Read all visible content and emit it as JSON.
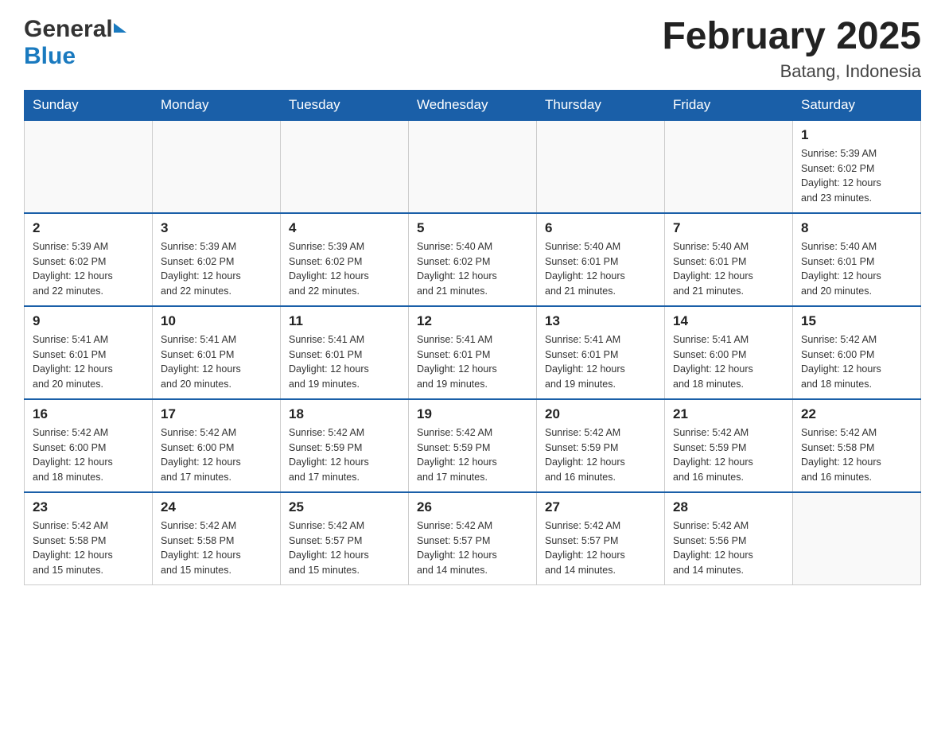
{
  "header": {
    "logo_general": "General",
    "logo_blue": "Blue",
    "month_title": "February 2025",
    "location": "Batang, Indonesia"
  },
  "weekdays": [
    "Sunday",
    "Monday",
    "Tuesday",
    "Wednesday",
    "Thursday",
    "Friday",
    "Saturday"
  ],
  "weeks": [
    [
      {
        "day": "",
        "info": ""
      },
      {
        "day": "",
        "info": ""
      },
      {
        "day": "",
        "info": ""
      },
      {
        "day": "",
        "info": ""
      },
      {
        "day": "",
        "info": ""
      },
      {
        "day": "",
        "info": ""
      },
      {
        "day": "1",
        "info": "Sunrise: 5:39 AM\nSunset: 6:02 PM\nDaylight: 12 hours\nand 23 minutes."
      }
    ],
    [
      {
        "day": "2",
        "info": "Sunrise: 5:39 AM\nSunset: 6:02 PM\nDaylight: 12 hours\nand 22 minutes."
      },
      {
        "day": "3",
        "info": "Sunrise: 5:39 AM\nSunset: 6:02 PM\nDaylight: 12 hours\nand 22 minutes."
      },
      {
        "day": "4",
        "info": "Sunrise: 5:39 AM\nSunset: 6:02 PM\nDaylight: 12 hours\nand 22 minutes."
      },
      {
        "day": "5",
        "info": "Sunrise: 5:40 AM\nSunset: 6:02 PM\nDaylight: 12 hours\nand 21 minutes."
      },
      {
        "day": "6",
        "info": "Sunrise: 5:40 AM\nSunset: 6:01 PM\nDaylight: 12 hours\nand 21 minutes."
      },
      {
        "day": "7",
        "info": "Sunrise: 5:40 AM\nSunset: 6:01 PM\nDaylight: 12 hours\nand 21 minutes."
      },
      {
        "day": "8",
        "info": "Sunrise: 5:40 AM\nSunset: 6:01 PM\nDaylight: 12 hours\nand 20 minutes."
      }
    ],
    [
      {
        "day": "9",
        "info": "Sunrise: 5:41 AM\nSunset: 6:01 PM\nDaylight: 12 hours\nand 20 minutes."
      },
      {
        "day": "10",
        "info": "Sunrise: 5:41 AM\nSunset: 6:01 PM\nDaylight: 12 hours\nand 20 minutes."
      },
      {
        "day": "11",
        "info": "Sunrise: 5:41 AM\nSunset: 6:01 PM\nDaylight: 12 hours\nand 19 minutes."
      },
      {
        "day": "12",
        "info": "Sunrise: 5:41 AM\nSunset: 6:01 PM\nDaylight: 12 hours\nand 19 minutes."
      },
      {
        "day": "13",
        "info": "Sunrise: 5:41 AM\nSunset: 6:01 PM\nDaylight: 12 hours\nand 19 minutes."
      },
      {
        "day": "14",
        "info": "Sunrise: 5:41 AM\nSunset: 6:00 PM\nDaylight: 12 hours\nand 18 minutes."
      },
      {
        "day": "15",
        "info": "Sunrise: 5:42 AM\nSunset: 6:00 PM\nDaylight: 12 hours\nand 18 minutes."
      }
    ],
    [
      {
        "day": "16",
        "info": "Sunrise: 5:42 AM\nSunset: 6:00 PM\nDaylight: 12 hours\nand 18 minutes."
      },
      {
        "day": "17",
        "info": "Sunrise: 5:42 AM\nSunset: 6:00 PM\nDaylight: 12 hours\nand 17 minutes."
      },
      {
        "day": "18",
        "info": "Sunrise: 5:42 AM\nSunset: 5:59 PM\nDaylight: 12 hours\nand 17 minutes."
      },
      {
        "day": "19",
        "info": "Sunrise: 5:42 AM\nSunset: 5:59 PM\nDaylight: 12 hours\nand 17 minutes."
      },
      {
        "day": "20",
        "info": "Sunrise: 5:42 AM\nSunset: 5:59 PM\nDaylight: 12 hours\nand 16 minutes."
      },
      {
        "day": "21",
        "info": "Sunrise: 5:42 AM\nSunset: 5:59 PM\nDaylight: 12 hours\nand 16 minutes."
      },
      {
        "day": "22",
        "info": "Sunrise: 5:42 AM\nSunset: 5:58 PM\nDaylight: 12 hours\nand 16 minutes."
      }
    ],
    [
      {
        "day": "23",
        "info": "Sunrise: 5:42 AM\nSunset: 5:58 PM\nDaylight: 12 hours\nand 15 minutes."
      },
      {
        "day": "24",
        "info": "Sunrise: 5:42 AM\nSunset: 5:58 PM\nDaylight: 12 hours\nand 15 minutes."
      },
      {
        "day": "25",
        "info": "Sunrise: 5:42 AM\nSunset: 5:57 PM\nDaylight: 12 hours\nand 15 minutes."
      },
      {
        "day": "26",
        "info": "Sunrise: 5:42 AM\nSunset: 5:57 PM\nDaylight: 12 hours\nand 14 minutes."
      },
      {
        "day": "27",
        "info": "Sunrise: 5:42 AM\nSunset: 5:57 PM\nDaylight: 12 hours\nand 14 minutes."
      },
      {
        "day": "28",
        "info": "Sunrise: 5:42 AM\nSunset: 5:56 PM\nDaylight: 12 hours\nand 14 minutes."
      },
      {
        "day": "",
        "info": ""
      }
    ]
  ]
}
